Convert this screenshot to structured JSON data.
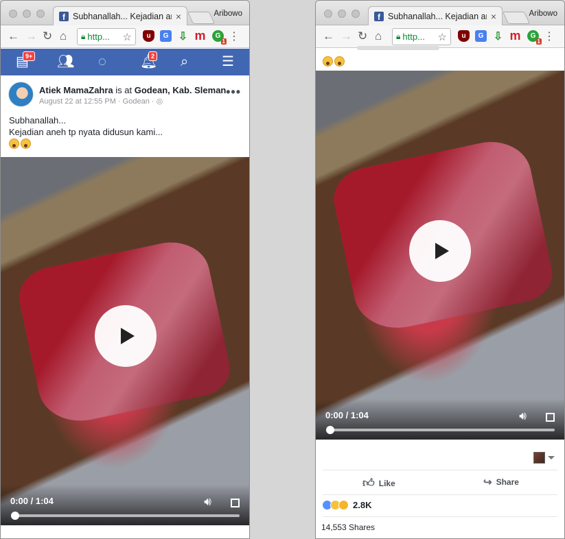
{
  "browser": {
    "tab_title": "Subhanallah... Kejadian aneh",
    "tab_close": "×",
    "profile_name": "Aribowo",
    "url": "http..."
  },
  "facebook_nav": {
    "home_badge": "9+",
    "notifications_badge": "2"
  },
  "post": {
    "author": "Atiek MamaZahra",
    "checkin_text": " is at ",
    "location": "Godean, Kab. Sleman",
    "meta": "August 22 at 12:55 PM · Godean · ",
    "text_line1": "Subhanallah...",
    "text_line2": "Kejadian aneh tp nyata didusun kami..."
  },
  "video": {
    "time": "0:00 / 1:04",
    "progress": 0
  },
  "actions": {
    "like_label": "Like",
    "share_label": "Share"
  },
  "stats": {
    "reaction_count": "2.8K",
    "shares": "14,553 Shares"
  },
  "colors": {
    "facebook_blue": "#4267b2",
    "badge_red": "#fa3e3e",
    "secure_green": "#0a8a34"
  },
  "icons": {
    "nav": [
      "home-feed-icon",
      "friends-icon",
      "messenger-icon",
      "notifications-bell-icon",
      "search-icon",
      "menu-icon"
    ],
    "toolbar": [
      "back-icon",
      "forward-icon",
      "reload-icon",
      "home-icon",
      "lock-icon",
      "star-icon"
    ]
  }
}
